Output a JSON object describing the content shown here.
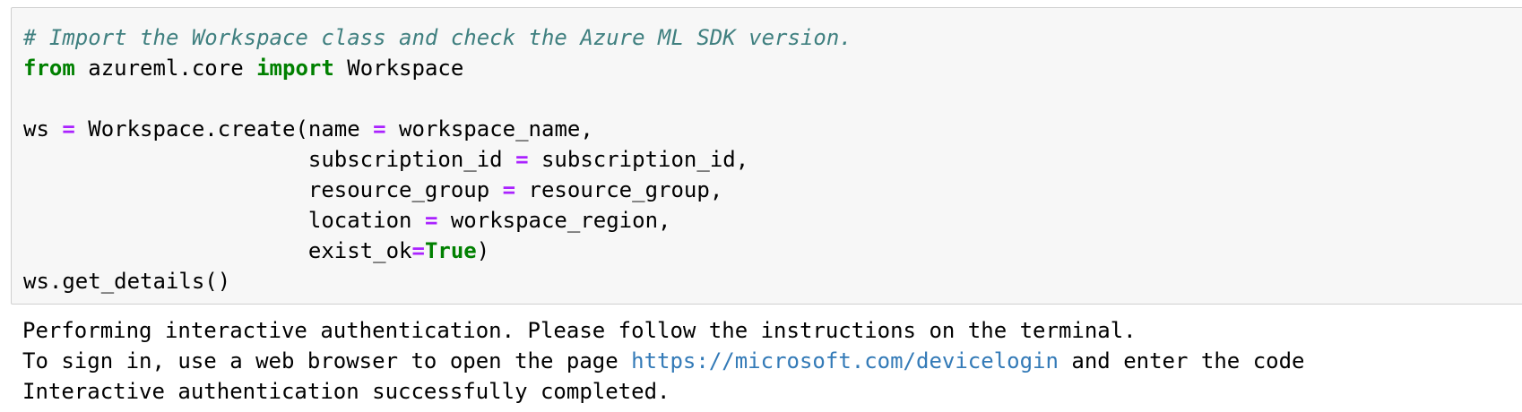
{
  "code_cell": {
    "comment": "# Import the Workspace class and check the Azure ML SDK version.",
    "line2": {
      "kw_from": "from",
      "module": " azureml.core ",
      "kw_import": "import",
      "name": " Workspace"
    },
    "line4": {
      "a": "ws ",
      "op": "=",
      "b": " Workspace.create(name ",
      "op2": "=",
      "c": " workspace_name,"
    },
    "line5": {
      "a": "                      subscription_id ",
      "op": "=",
      "b": " subscription_id,"
    },
    "line6": {
      "a": "                      resource_group ",
      "op": "=",
      "b": " resource_group,"
    },
    "line7": {
      "a": "                      location ",
      "op": "=",
      "b": " workspace_region,"
    },
    "line8": {
      "a": "                      exist_ok",
      "op": "=",
      "kw": "True",
      "b": ")"
    },
    "line9": "ws.get_details()"
  },
  "output": {
    "line1": "Performing interactive authentication. Please follow the instructions on the terminal.",
    "line2_prefix": "To sign in, use a web browser to open the page ",
    "line2_link": "https://microsoft.com/devicelogin",
    "line2_suffix": " and enter the code",
    "line3": "Interactive authentication successfully completed."
  },
  "colors": {
    "comment": "#408080",
    "keyword": "#008000",
    "operator": "#aa22ff",
    "link": "#337ab7",
    "cell_background": "#f7f7f7",
    "cell_border": "#cfcfcf"
  }
}
